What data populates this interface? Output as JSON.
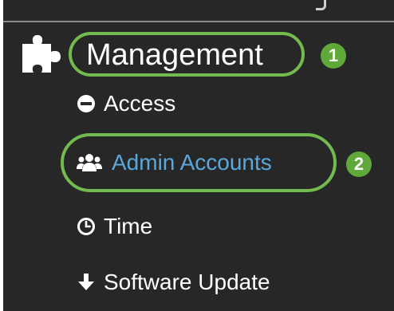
{
  "nav": {
    "section": {
      "label": "Management",
      "icon": "puzzle-icon",
      "step_badge": "1"
    },
    "items": [
      {
        "label": "Access",
        "icon": "minus-circle-icon"
      },
      {
        "label": "Admin Accounts",
        "icon": "users-group-icon",
        "highlighted": true,
        "step_badge": "2"
      },
      {
        "label": "Time",
        "icon": "clock-icon"
      },
      {
        "label": "Software Update",
        "icon": "arrow-down-icon"
      }
    ]
  },
  "colors": {
    "panel_background": "#272727",
    "text": "#ffffff",
    "active_link": "#5aa9dc",
    "highlight_ring": "#73bb4e",
    "badge": "#5fa93a"
  }
}
